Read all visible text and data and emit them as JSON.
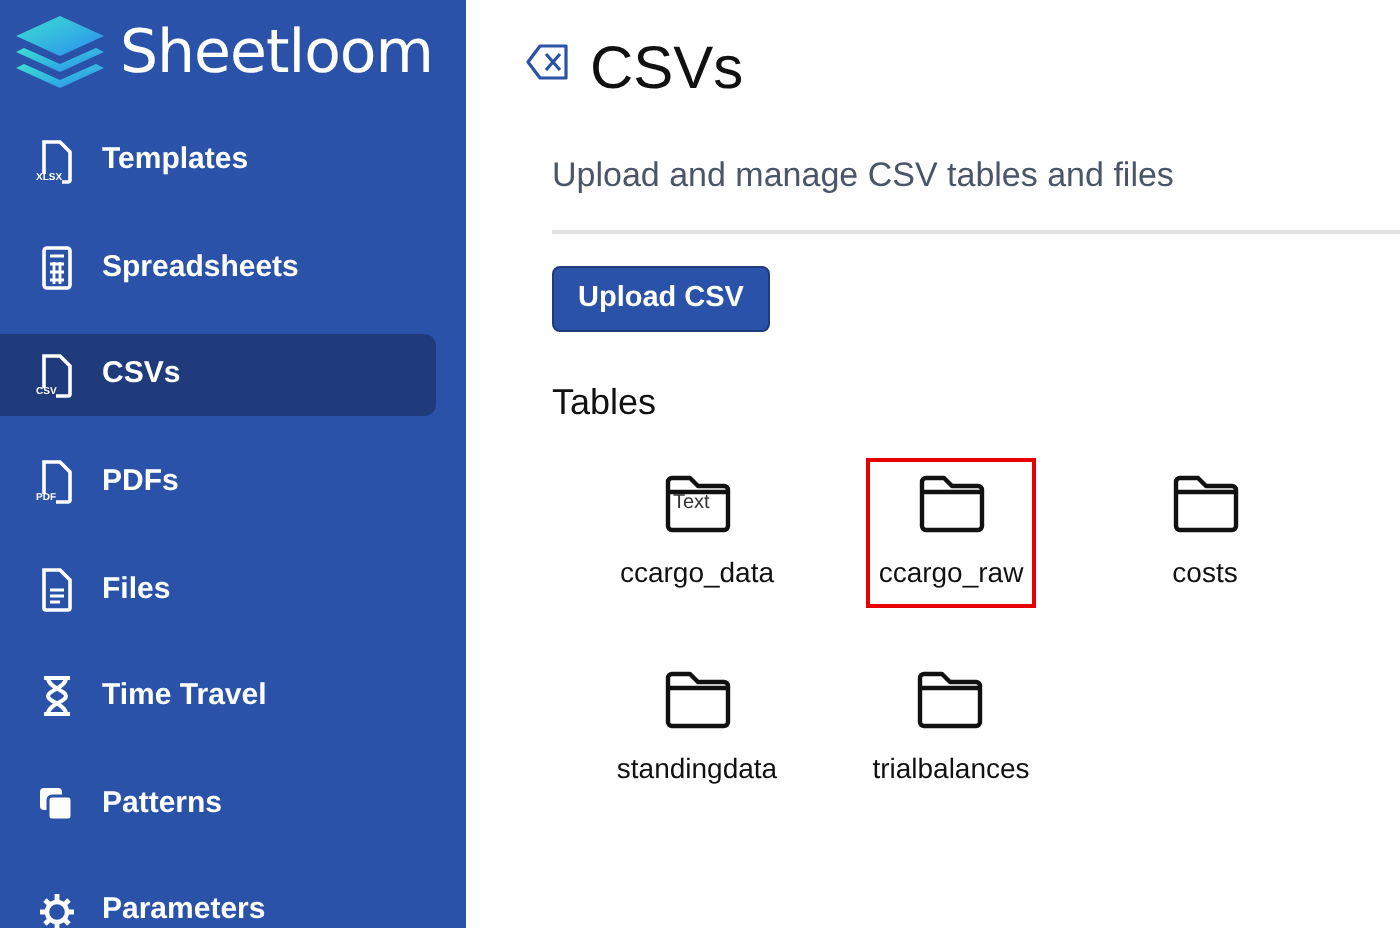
{
  "app": {
    "name": "Sheetloom"
  },
  "sidebar": {
    "items": [
      {
        "label": "Templates",
        "kind": "xlsx",
        "icon_text": "XLSX",
        "selected": false
      },
      {
        "label": "Spreadsheets",
        "kind": "grid",
        "selected": false
      },
      {
        "label": "CSVs",
        "kind": "csv",
        "icon_text": "CSV",
        "selected": true
      },
      {
        "label": "PDFs",
        "kind": "pdf",
        "icon_text": "PDF",
        "selected": false
      },
      {
        "label": "Files",
        "kind": "file",
        "selected": false
      },
      {
        "label": "Time Travel",
        "kind": "hourglass",
        "selected": false
      },
      {
        "label": "Patterns",
        "kind": "squares",
        "selected": false
      },
      {
        "label": "Parameters",
        "kind": "gear",
        "selected": false
      }
    ]
  },
  "page": {
    "title": "CSVs",
    "subtitle": "Upload and manage CSV tables and files",
    "upload_button": "Upload CSV",
    "section_title": "Tables",
    "tables": [
      {
        "name": "ccargo_data",
        "icon_text": "Text",
        "selected": false
      },
      {
        "name": "ccargo_raw",
        "selected": true
      },
      {
        "name": "costs",
        "selected": false
      },
      {
        "name": "standingdata",
        "selected": false
      },
      {
        "name": "trialbalances",
        "selected": false
      }
    ]
  }
}
